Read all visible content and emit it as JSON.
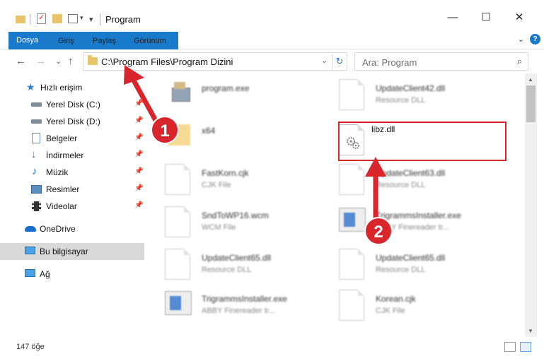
{
  "window": {
    "title": "Program",
    "minimize": "—",
    "maximize": "☐",
    "close": "✕"
  },
  "ribbon": {
    "tabs": [
      "Dosya",
      "Giriş",
      "Paylaş",
      "Görünüm"
    ],
    "expand": "⌄",
    "help": "?"
  },
  "nav": {
    "back": "←",
    "forward": "→",
    "recent": "⌄",
    "up": "↑",
    "address": "C:\\Program Files\\Program Dizini",
    "search_placeholder": "Ara: Program"
  },
  "sidebar": {
    "items": [
      {
        "label": "Hızlı erişim",
        "icon": "star-icon",
        "pinned": false
      },
      {
        "label": "Yerel Disk (C:)",
        "icon": "drive-icon",
        "pinned": true
      },
      {
        "label": "Yerel Disk (D:)",
        "icon": "drive-icon",
        "pinned": true
      },
      {
        "label": "Belgeler",
        "icon": "document-icon",
        "pinned": true
      },
      {
        "label": "İndirmeler",
        "icon": "download-icon",
        "pinned": true
      },
      {
        "label": "Müzik",
        "icon": "music-icon",
        "pinned": true
      },
      {
        "label": "Resimler",
        "icon": "pictures-icon",
        "pinned": true
      },
      {
        "label": "Videolar",
        "icon": "video-icon",
        "pinned": true
      },
      {
        "label": "OneDrive",
        "icon": "cloud-icon",
        "pinned": false
      },
      {
        "label": "Bu bilgisayar",
        "icon": "computer-icon",
        "pinned": false
      },
      {
        "label": "Ağ",
        "icon": "network-icon",
        "pinned": false
      }
    ]
  },
  "files": [
    {
      "name": "program.exe",
      "type": "",
      "icon": "exe-icon"
    },
    {
      "name": "UpdateClient42.dll",
      "type": "Resource DLL",
      "icon": "dll-icon"
    },
    {
      "name": "x64",
      "type": "",
      "icon": "folder-icon"
    },
    {
      "name": "libz.dll",
      "type": "",
      "icon": "dll-icon"
    },
    {
      "name": "FastKorn.cjk",
      "type": "CJK File",
      "icon": "file-icon"
    },
    {
      "name": "UpdateClient63.dll",
      "type": "Resource DLL",
      "icon": "dll-icon"
    },
    {
      "name": "SndToWP16.wcm",
      "type": "WCM File",
      "icon": "file-icon"
    },
    {
      "name": "TrigrammsInstaller.exe",
      "type": "ABBY Finereader tr...",
      "icon": "installer-icon"
    },
    {
      "name": "UpdateClient65.dll",
      "type": "Resource DLL",
      "icon": "dll-icon"
    },
    {
      "name": "UpdateClient65.dll",
      "type": "Resource DLL",
      "icon": "dll-icon"
    },
    {
      "name": "TrigrammsInstaller.exe",
      "type": "ABBY Finereader tr...",
      "icon": "installer-icon"
    },
    {
      "name": "Korean.cjk",
      "type": "CJK File",
      "icon": "file-icon"
    }
  ],
  "status": {
    "count": "147 öğe"
  },
  "annotations": {
    "step1": "1",
    "step2": "2",
    "color": "#d8262c"
  }
}
